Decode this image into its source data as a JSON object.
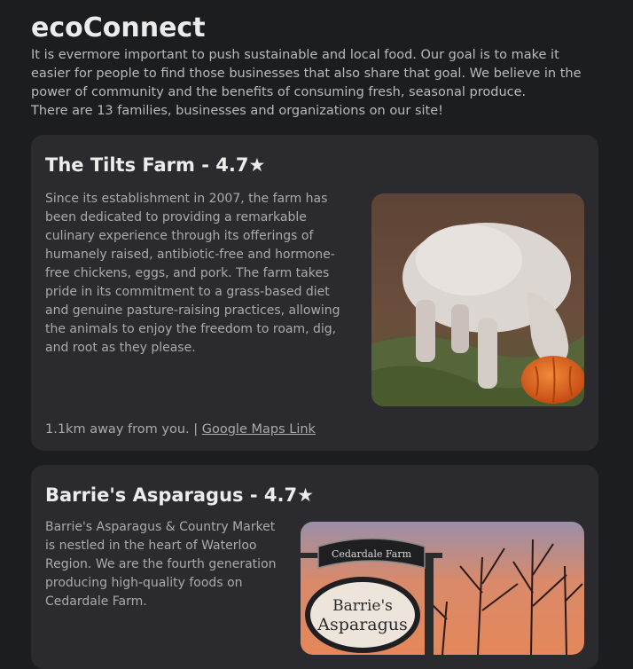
{
  "site": {
    "title": "ecoConnect",
    "intro": "It is evermore important to push sustainable and local food. Our goal is to make it easier for people to find those businesses that also share that goal. We believe in the power of community and the benefits of consuming fresh, seasonal produce.",
    "count_text": "There are 13 families, businesses and organizations on our site!"
  },
  "listings": [
    {
      "name": "The Tilts Farm - 4.7★",
      "description": "Since its establishment in 2007, the farm has been dedicated to providing a remarkable culinary experience through its offerings of humanely raised, antibiotic-free and hormone-free chickens, eggs, and pork. The farm takes pride in its commitment to a grass-based diet and genuine pasture-raising practices, allowing the animals to enjoy the freedom to roam, dig, and root as they please.",
      "distance": "1.1km away from you. |",
      "map_link": "Google Maps Link",
      "image": "pig-with-pumpkin"
    },
    {
      "name": "Barrie's Asparagus - 4.7★",
      "description": "Barrie's Asparagus & Country Market is nestled in the heart of Waterloo Region. We are the fourth generation producing high-quality foods on Cedardale Farm.",
      "image": "farm-sign-at-sunset",
      "sign_text": {
        "top": "Cedardale Farm",
        "main_line1": "Barrie's",
        "main_line2": "Asparagus"
      }
    }
  ],
  "colors": {
    "background": "#1c1d1f",
    "card": "#2b2b2f",
    "heading": "#ececec",
    "text": "#a9aaae"
  }
}
